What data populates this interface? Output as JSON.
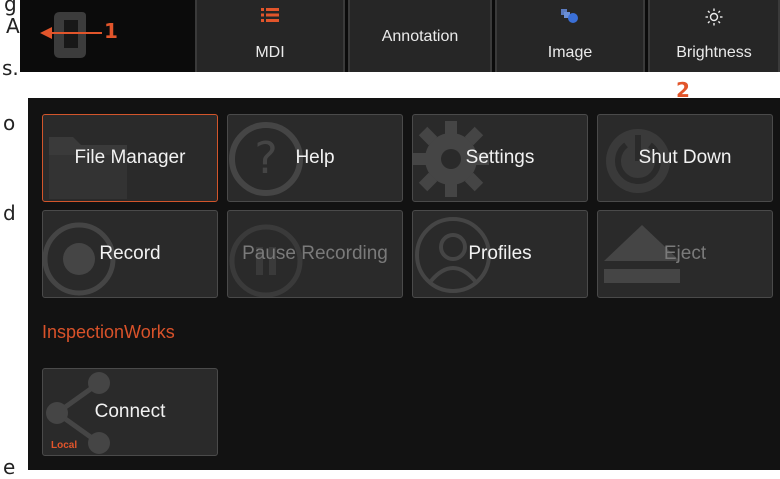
{
  "edge_text": [
    "g",
    "A",
    "s.",
    "o",
    "d",
    "e"
  ],
  "toolbar": {
    "buttons": [
      {
        "label": "MDI",
        "icon": "list-icon"
      },
      {
        "label": "Annotation",
        "icon": ""
      },
      {
        "label": "Image",
        "icon": "image-icon"
      },
      {
        "label": "Brightness",
        "icon": "sun-icon"
      }
    ]
  },
  "callouts": [
    "1",
    "2"
  ],
  "menu": {
    "tiles": [
      {
        "label": "File Manager",
        "icon": "folder-icon",
        "selected": true,
        "enabled": true
      },
      {
        "label": "Help",
        "icon": "question-icon",
        "enabled": true
      },
      {
        "label": "Settings",
        "icon": "gear-icon",
        "enabled": true
      },
      {
        "label": "Shut Down",
        "icon": "power-icon",
        "enabled": true
      },
      {
        "label": "Record",
        "icon": "record-icon",
        "enabled": true
      },
      {
        "label": "Pause Recording",
        "icon": "pause-icon",
        "enabled": false
      },
      {
        "label": "Profiles",
        "icon": "user-icon",
        "enabled": true
      },
      {
        "label": "Eject",
        "icon": "eject-icon",
        "enabled": false
      }
    ],
    "section_title": "InspectionWorks",
    "connect": {
      "label": "Connect",
      "sublabel": "Local",
      "icon": "share-icon"
    }
  },
  "colors": {
    "accent": "#e2552b",
    "panel": "#121212",
    "tile": "#2a2a2a"
  }
}
